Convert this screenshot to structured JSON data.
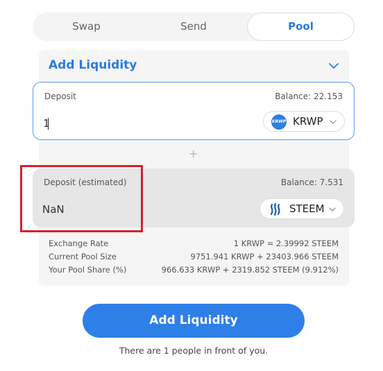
{
  "tabs": [
    {
      "label": "Swap"
    },
    {
      "label": "Send"
    },
    {
      "label": "Pool"
    }
  ],
  "active_tab": "Pool",
  "section": {
    "title": "Add Liquidity",
    "chevron_icon": "chevron-down-icon"
  },
  "deposit": {
    "label": "Deposit",
    "balance": "Balance: 22.153",
    "amount": "1",
    "token": "KRWP",
    "token_logo_text": "KRWP"
  },
  "plus_symbol": "+",
  "estimated": {
    "label": "Deposit (estimated)",
    "balance": "Balance: 7.531",
    "amount": "NaN",
    "token": "STEEM"
  },
  "info": [
    {
      "label": "Exchange Rate",
      "value": "1 KRWP = 2.39992 STEEM"
    },
    {
      "label": "Current Pool Size",
      "value": "9751.941 KRWP + 23403.966 STEEM"
    },
    {
      "label": "Your Pool Share (%)",
      "value": "966.633 KRWP + 2319.852 STEEM (9.912%)"
    }
  ],
  "submit_label": "Add Liquidity",
  "queue_note": "There are 1 people in front of you.",
  "colors": {
    "accent": "#2b7be0",
    "button": "#2f7fe8",
    "highlight": "#d7202a"
  }
}
